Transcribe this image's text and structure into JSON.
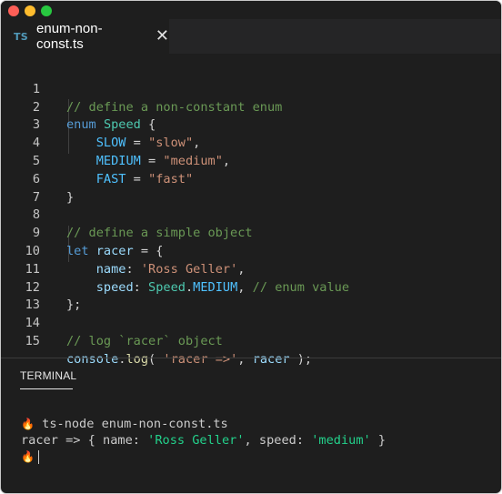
{
  "tab": {
    "lang": "TS",
    "filename": "enum-non-const.ts",
    "close": "✕"
  },
  "editor": {
    "lines": [
      {
        "n": "1"
      },
      {
        "n": "2"
      },
      {
        "n": "3"
      },
      {
        "n": "4"
      },
      {
        "n": "5"
      },
      {
        "n": "6"
      },
      {
        "n": "7"
      },
      {
        "n": "8"
      },
      {
        "n": "9"
      },
      {
        "n": "10"
      },
      {
        "n": "11"
      },
      {
        "n": "12"
      },
      {
        "n": "13"
      },
      {
        "n": "14"
      },
      {
        "n": "15"
      }
    ],
    "code": {
      "l1_comment": "// define a non-constant enum",
      "l2_kw": "enum",
      "l2_name": "Speed",
      "l2_brace": " {",
      "l3_key": "SLOW",
      "l3_eq": " = ",
      "l3_val": "\"slow\"",
      "l3_end": ",",
      "l4_key": "MEDIUM",
      "l4_eq": " = ",
      "l4_val": "\"medium\"",
      "l4_end": ",",
      "l5_key": "FAST",
      "l5_eq": " = ",
      "l5_val": "\"fast\"",
      "l6_brace": "}",
      "l8_comment": "// define a simple object",
      "l9_kw": "let",
      "l9_var": "racer",
      "l9_rest": " = {",
      "l10_key": "name",
      "l10_colon": ": ",
      "l10_val": "'Ross Geller'",
      "l10_end": ",",
      "l11_key": "speed",
      "l11_colon": ": ",
      "l11_enum": "Speed",
      "l11_dot": ".",
      "l11_member": "MEDIUM",
      "l11_comma": ", ",
      "l11_comment": "// enum value",
      "l12_close": "};",
      "l14_comment": "// log `racer` object",
      "l15_obj": "console",
      "l15_dot": ".",
      "l15_fn": "log",
      "l15_open": "( ",
      "l15_str": "'racer =>'",
      "l15_comma": ", ",
      "l15_var": "racer",
      "l15_close": " );"
    }
  },
  "panel": {
    "tab_label": "TERMINAL"
  },
  "terminal": {
    "prompt_icon": "🔥",
    "command": " ts-node enum-non-const.ts",
    "out_prefix": "racer => { name: ",
    "out_name": "'Ross Geller'",
    "out_mid": ", speed: ",
    "out_speed": "'medium'",
    "out_end": " }"
  }
}
